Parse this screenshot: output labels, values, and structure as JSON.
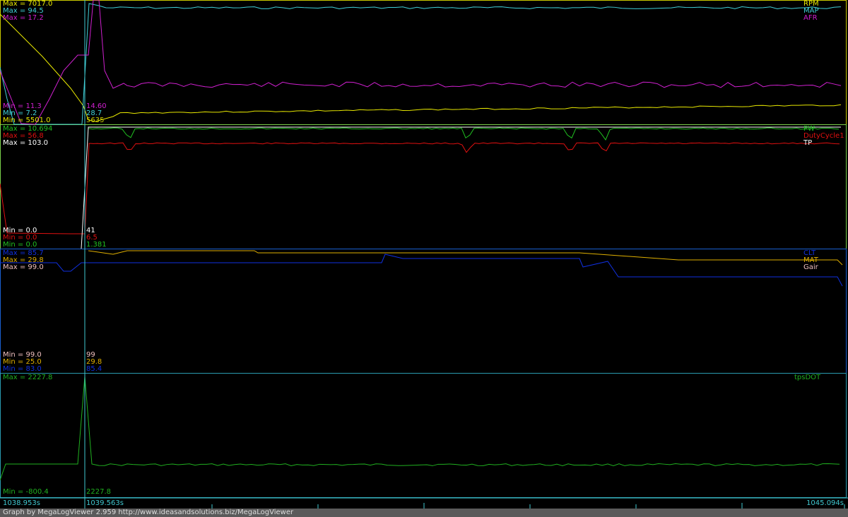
{
  "colors": {
    "rpm": "#e8e800",
    "map": "#40d0d8",
    "afr": "#d020d0",
    "pw": "#20c020",
    "duty": "#e01010",
    "tp": "#ffffff",
    "clt": "#1030e0",
    "mat": "#e0b000",
    "gair": "#f0c0c0",
    "tpsdot": "#20b020",
    "cursor": "#40c8d0"
  },
  "panels": [
    {
      "labels": [
        "RPM",
        "MAP",
        "AFR"
      ],
      "max": [
        "Max = 7017.0",
        "Max = 94.5",
        "Max = 17.2"
      ],
      "min": [
        "Min = 11.3",
        "Min = 7.2",
        "Min = 5501.0"
      ],
      "cursor": [
        "14.60",
        "28.7",
        "5635"
      ]
    },
    {
      "labels": [
        "PW",
        "DutyCycle1",
        "TP"
      ],
      "max": [
        "Max = 10.694",
        "Max = 56.8",
        "Max = 103.0"
      ],
      "min": [
        "Min = 0.0",
        "Min = 0.0",
        "Min = 0.0"
      ],
      "cursor": [
        "41",
        "6.5",
        "1.381"
      ]
    },
    {
      "labels": [
        "CLT",
        "MAT",
        "Gair"
      ],
      "max": [
        "Max = 85.7",
        "Max = 29.8",
        "Max = 99.0"
      ],
      "min": [
        "Min = 99.0",
        "Min = 25.0",
        "Min = 83.0"
      ],
      "cursor": [
        "99",
        "29.8",
        "85.4"
      ]
    },
    {
      "labels": [
        "tpsDOT"
      ],
      "max": [
        "Max = 2227.8"
      ],
      "min": [
        "Min = -800.4"
      ],
      "cursor": [
        "2227.8"
      ]
    }
  ],
  "time_axis": {
    "start": "1038.953s",
    "cursor": "1039.563s",
    "end": "1045.094s"
  },
  "footer": "Graph by MegaLogViewer 2.959 http://www.ideasandsolutions.biz/MegaLogViewer"
}
